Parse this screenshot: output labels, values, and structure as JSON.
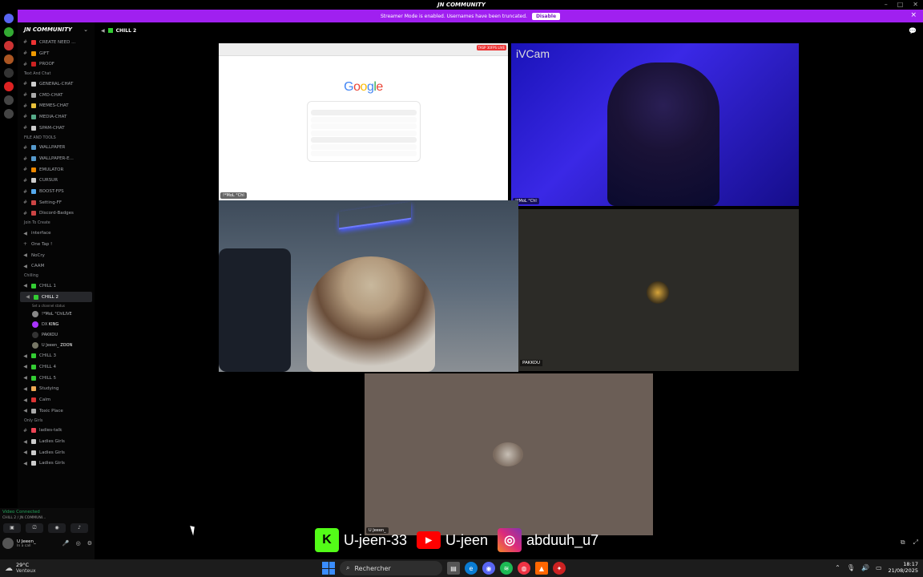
{
  "window": {
    "title": "JN COMMUNITY"
  },
  "banner": {
    "text": "Streamer Mode is enabled. Usernames have been truncated.",
    "button": "Disable"
  },
  "server": {
    "name": "JN COMMUNITY"
  },
  "sidebar": {
    "top_channels": [
      "CREATE NEED ...",
      "GIFT",
      "PROOF"
    ],
    "cat_text": "Text And Chat",
    "text_channels": [
      "GENERAL-CHAT",
      "CMD-CHAT",
      "MEMES-CHAT",
      "MEDIA-CHAT",
      "SPAM-CHAT"
    ],
    "cat_files": "FILE AND TOOLS",
    "file_channels": [
      "WALLPAPER",
      "WALLPAPER-E...",
      "EMULATOR",
      "CURSUR",
      "BOOST-FPS",
      "Setting-FF",
      "Discord-Badges"
    ],
    "cat_join": "Join To Create",
    "join_channels": [
      "interface",
      "One Tap !",
      "NoCry",
      "CAAM"
    ],
    "cat_chilling": "Chilling",
    "chill_before": [
      "CHILL 1"
    ],
    "active_channel": "CHILL 2",
    "active_status": "Set a channel status",
    "live_badge": "LIVE",
    "voice_users": [
      "!*MoL °Chl",
      "DX",
      "PAKKOU",
      "U Jeeen_"
    ],
    "voice_user_badges": [
      "",
      "KING",
      "",
      "ZOON"
    ],
    "chill_after": [
      "CHILL 3",
      "CHILL 4",
      "CHILL 5",
      "Studying",
      "Calm",
      "Toxic Place"
    ],
    "cat_girls": "Only Girls",
    "girl_channels": [
      "ladies-talk",
      "Ladies Girls",
      "Ladies Girls",
      "Ladies Girls"
    ]
  },
  "voice_panel": {
    "status": "Video Connected",
    "channel": "CHILL 2 / JN COMMUNI...",
    "user": "U Jeeen_",
    "user_status": "In a call"
  },
  "topbar": {
    "channel": "CHILL 2"
  },
  "tiles": {
    "screen_label": "!*MoL °Chl",
    "screen_live": "LIVE",
    "screen_badge": "TASP 30FPS",
    "google_logo": "Google",
    "cam_label": "iVCam",
    "cam_user": "!*MoL °Chl",
    "pakkou_label": "PAKKOU",
    "ujeeen_label": "U Jeeen_"
  },
  "overlay": {
    "kick": "U-jeen-33",
    "youtube": "U-jeen",
    "instagram": "abduuh_u7"
  },
  "taskbar": {
    "temp": "29°C",
    "weather": "Venteux",
    "search": "Rechercher",
    "time": "18:17",
    "date": "21/08/2025"
  }
}
